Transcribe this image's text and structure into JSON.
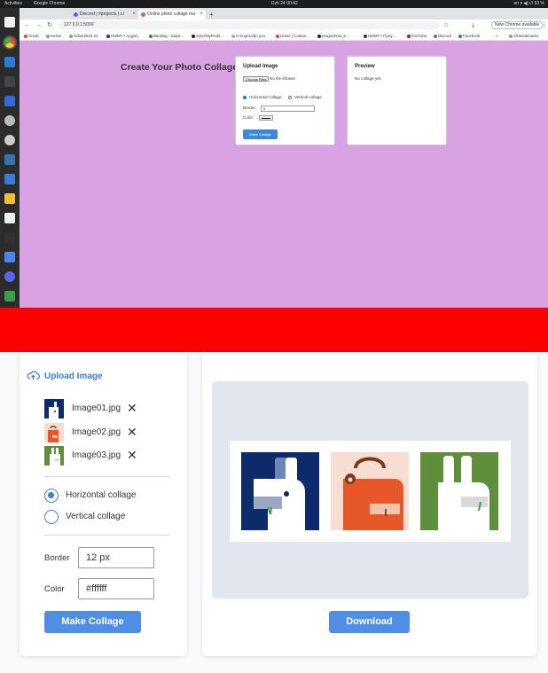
{
  "system_bar": {
    "activities": "Activities",
    "app_name": "Google Chrome",
    "clock": "Dzh 24  00:42",
    "status": "en   ▾   ◀)  ⏻  53 %"
  },
  "browser": {
    "tabs": [
      {
        "label": "Discord | #projects | s.i"
      },
      {
        "label": "Online photo collage ma"
      }
    ],
    "new_tab": "+",
    "url": "127.0.0.1:5000",
    "update_button": "New Chrome available",
    "bookmarks": [
      "Gmail",
      "Helios",
      "helios2023-24",
      "HMMY • Αρχική",
      "Backlog - SaaS...",
      "SolveMyProbl...",
      "Η Κοριτσι/βο you",
      "Home | Codew...",
      "programma_e...",
      "HMMY • Πρόγ...",
      "YouTube",
      "Discord",
      "Facebook"
    ],
    "all_bookmarks": "All Bookmarks"
  },
  "page": {
    "heading": "Create Your Photo Collage",
    "upload_card": {
      "title": "Upload Image",
      "choose_files": "Choose Files",
      "no_file": "No file chosen",
      "horizontal": "Horizontal collage",
      "vertical": "Vertical collage",
      "border_label": "Border:",
      "border_value": "5",
      "color_label": "Color:",
      "make_button": "Make Collage"
    },
    "preview_card": {
      "title": "Preview",
      "empty_text": "No collage yet."
    }
  },
  "zoom": {
    "upload_link": "Upload Image",
    "files": [
      {
        "name": "Image01.jpg"
      },
      {
        "name": "Image02.jpg"
      },
      {
        "name": "Image03.jpg"
      }
    ],
    "remove_glyph": "✕",
    "orientation": {
      "horizontal": "Horizontal collage",
      "vertical": "Vertical collage",
      "selected": "horizontal"
    },
    "border_label": "Border",
    "border_value": "12 px",
    "color_label": "Color",
    "color_value": "#ffffff",
    "make_button": "Make Collage",
    "download_button": "Download"
  },
  "colors": {
    "page_bg": "#d8a2e3",
    "band": "#fe0000",
    "accent": "#4f8ee5",
    "link": "#3a7fcf",
    "preview_area": "#e2e6ee"
  }
}
